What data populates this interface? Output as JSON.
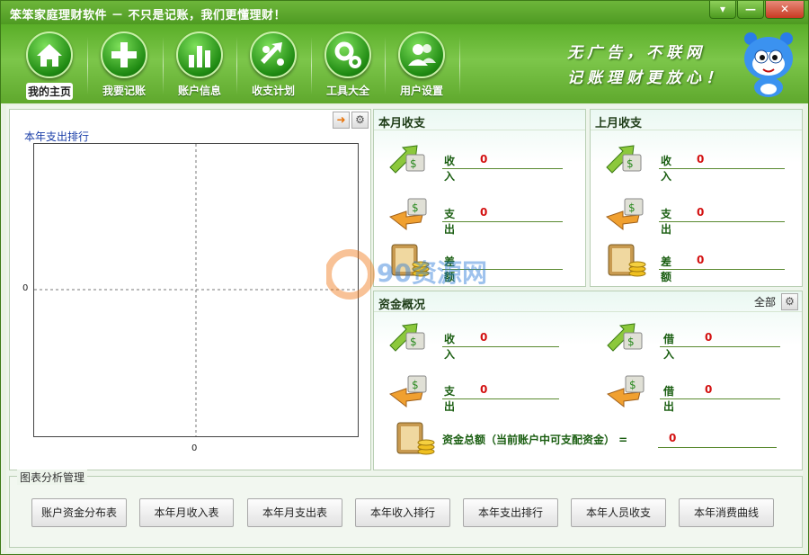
{
  "window": {
    "title": "笨笨家庭理财软件  － 不只是记账，我们更懂理财！",
    "controls": {
      "menu": "▾",
      "minimize": "—",
      "close": "✕"
    }
  },
  "toolbar": {
    "items": [
      {
        "label": "我的主页",
        "icon": "home-icon"
      },
      {
        "label": "我要记账",
        "icon": "plus-icon"
      },
      {
        "label": "账户信息",
        "icon": "bar-chart-icon"
      },
      {
        "label": "收支计划",
        "icon": "exchange-arrows-icon"
      },
      {
        "label": "工具大全",
        "icon": "gears-icon"
      },
      {
        "label": "用户设置",
        "icon": "users-icon"
      }
    ],
    "slogan_line1": "无广告，不联网",
    "slogan_line2": "记账理财更放心！"
  },
  "chart": {
    "title": "本年支出排行",
    "y_zero_label": "0",
    "x_zero_label": "0"
  },
  "chart_data": {
    "type": "bar",
    "title": "本年支出排行",
    "categories": [],
    "values": [],
    "yticks": [
      "0"
    ],
    "xticks": [
      "0"
    ],
    "grid": "dashed crosshair at zero"
  },
  "this_month": {
    "title": "本月收支",
    "rows": [
      {
        "label": "收入",
        "value": "0",
        "icon": "income-arrow-icon"
      },
      {
        "label": "支出",
        "value": "0",
        "icon": "expense-arrow-icon"
      },
      {
        "label": "差额",
        "value": "0",
        "icon": "coins-wallet-icon"
      }
    ]
  },
  "last_month": {
    "title": "上月收支",
    "rows": [
      {
        "label": "收入",
        "value": "0",
        "icon": "income-arrow-icon"
      },
      {
        "label": "支出",
        "value": "0",
        "icon": "expense-arrow-icon"
      },
      {
        "label": "差额",
        "value": "0",
        "icon": "coins-wallet-icon"
      }
    ]
  },
  "funds": {
    "title": "资金概况",
    "all_label": "全部",
    "left_rows": [
      {
        "label": "收入",
        "value": "0"
      },
      {
        "label": "支出",
        "value": "0"
      }
    ],
    "right_rows": [
      {
        "label": "借入",
        "value": "0"
      },
      {
        "label": "借出",
        "value": "0"
      }
    ],
    "total_label": "资金总额（当前账户中可支配资金）  =",
    "total_value": "0"
  },
  "analysis": {
    "title": "图表分析管理",
    "buttons": [
      "账户资金分布表",
      "本年月收入表",
      "本年月支出表",
      "本年收入排行",
      "本年支出排行",
      "本年人员收支",
      "本年消费曲线"
    ]
  },
  "watermark": "90资源网 90ziyuan.com",
  "colors": {
    "brand_green": "#5aae28",
    "value_red": "#d31010",
    "label_green": "#195d10",
    "chart_title_blue": "#1a3ea8"
  }
}
